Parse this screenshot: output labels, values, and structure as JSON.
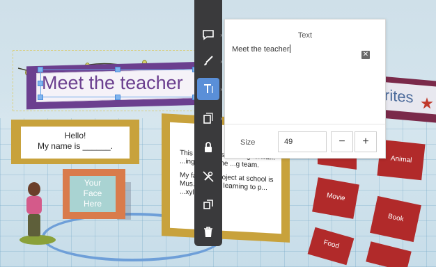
{
  "title_banner": {
    "text": "Meet the teacher"
  },
  "hello_card": {
    "line1": "Hello!",
    "line2": "My name is ______."
  },
  "face_card": {
    "line1": "Your",
    "line2": "Face",
    "line3": "Here"
  },
  "bio_card": {
    "para1": "This y... ...most looking forwa... ...ing out for the ...g team.",
    "para2": "My favorite project at school is Mus... ...e I'm learning to p... ...xylophone."
  },
  "favorites_banner": {
    "text": "rites"
  },
  "topic_cards": {
    "animal": "Animal",
    "movie": "Movie",
    "book": "Book",
    "food": "Food"
  },
  "toolbar": {
    "items": [
      {
        "icon": "speech-bubble-icon"
      },
      {
        "icon": "brush-icon"
      },
      {
        "icon": "text-icon",
        "active": true
      },
      {
        "icon": "layer-icon"
      },
      {
        "icon": "lock-icon"
      },
      {
        "icon": "no-tools-icon"
      },
      {
        "icon": "copy-icon"
      },
      {
        "icon": "trash-icon"
      }
    ]
  },
  "text_panel": {
    "title": "Text",
    "value": "Meet the teacher",
    "clear_label": "✕",
    "size_label": "Size",
    "size_value": "49",
    "minus_label": "−",
    "plus_label": "+"
  },
  "colors": {
    "accent": "#5a8fd8",
    "banner": "#6b3f8f",
    "card_red": "#b12a2a",
    "card_gold": "#c8a23c"
  }
}
